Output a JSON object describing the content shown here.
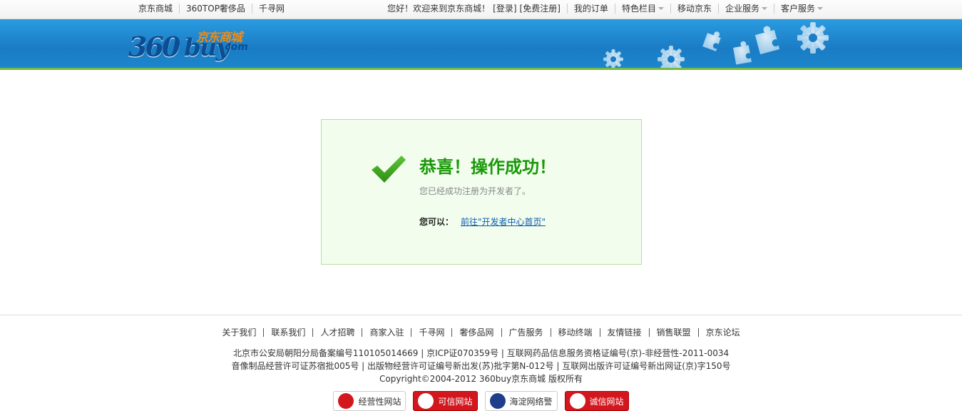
{
  "topbar": {
    "left_links": [
      "京东商城",
      "360TOP奢侈品",
      "千寻网"
    ],
    "welcome": "您好！欢迎来到京东商城！",
    "login": "[登录]",
    "register": "[免费注册]",
    "my_orders": "我的订单",
    "special": "特色栏目",
    "mobile": "移动京东",
    "enterprise": "企业服务",
    "customer": "客户服务"
  },
  "logo": {
    "part_360": "360",
    "part_buy": "buy",
    "cn": "京东商城",
    "com": ".com"
  },
  "result": {
    "title": "恭喜！操作成功！",
    "message": "您已经成功注册为开发者了。",
    "options_label": "您可以：",
    "link": "前往\"开发者中心首页\""
  },
  "footer": {
    "links": [
      "关于我们",
      "联系我们",
      "人才招聘",
      "商家入驻",
      "千寻网",
      "奢侈品网",
      "广告服务",
      "移动终端",
      "友情链接",
      "销售联盟",
      "京东论坛"
    ],
    "line1": "北京市公安局朝阳分局备案编号110105014669 | 京ICP证070359号 | 互联网药品信息服务资格证编号(京)-非经营性-2011-0034",
    "line2": "音像制品经营许可证苏宿批005号 | 出版物经营许可证编号新出发(苏)批字第N-012号 | 互联网出版许可证编号新出网证(京)字150号",
    "line3": "Copyright©2004-2012  360buy京东商城 版权所有",
    "badges": [
      "经营性网站",
      "可信网站",
      "海淀网络警",
      "诚信网站"
    ]
  },
  "colors": {
    "banner": "#1a7cc4",
    "success_green": "#199808",
    "link_blue": "#0b5db0",
    "box_bg": "#f2fdee"
  }
}
